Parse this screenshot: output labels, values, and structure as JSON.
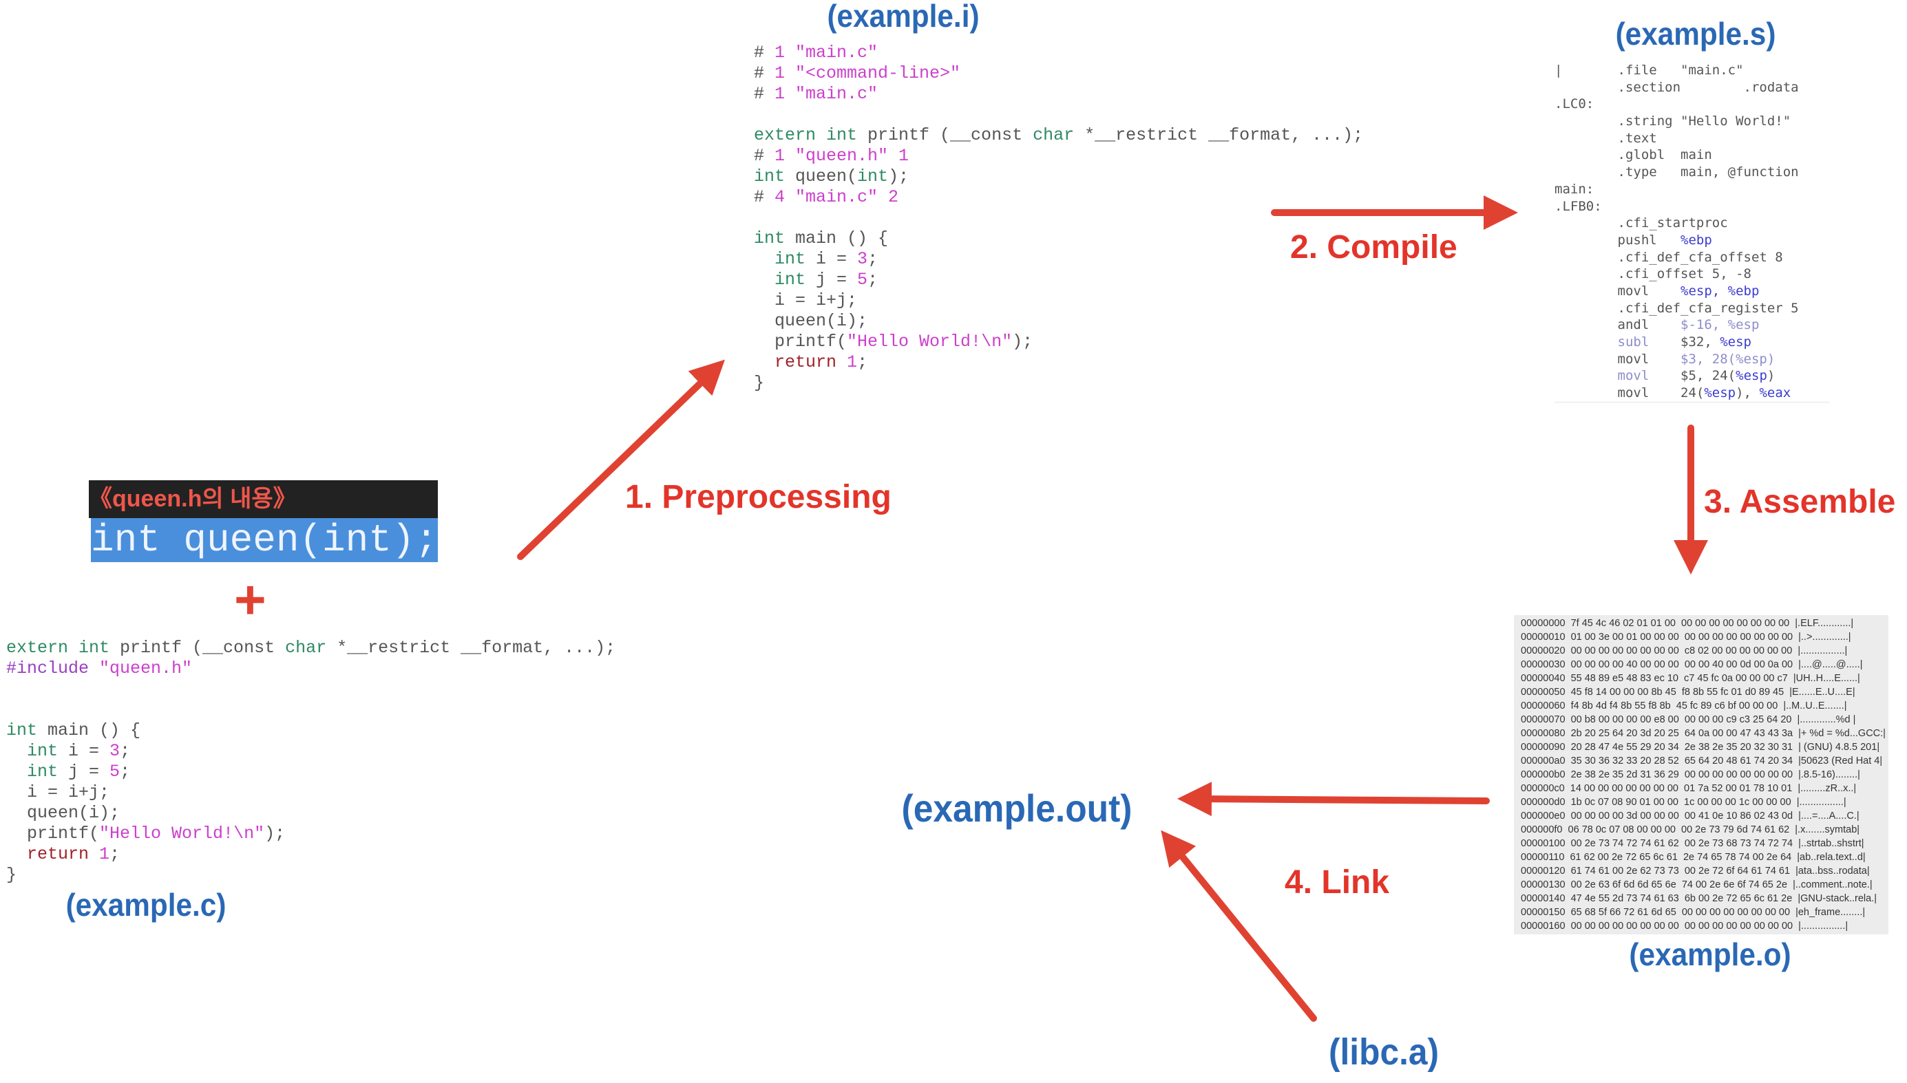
{
  "colors": {
    "kw": "#2f8a63",
    "str": "#cc3fcc",
    "num": "#cc3fcc",
    "ret": "#a0222a",
    "txt": "#555555",
    "pre": "#9b3fc0",
    "reg": "#3b3bd0",
    "faint": "#8d8dcc",
    "arrow": "#e04232",
    "step": "#e3342a",
    "title": "#2a68b5"
  },
  "titles": {
    "example_i": "(example.i)",
    "example_s": "(example.s)",
    "example_o": "(example.o)",
    "example_c": "(example.c)",
    "example_out": "(example.out)",
    "libc": "(libc.a)"
  },
  "steps": {
    "preprocessing": "1.  Preprocessing",
    "compile": "2.  Compile",
    "assemble": "3.  Assemble",
    "link": "4.  Link"
  },
  "queen_header": {
    "title": "《queen.h의 내용》",
    "content": "int queen(int);"
  },
  "plus": "+",
  "example_i_code": [
    [
      [
        "# ",
        "txt"
      ],
      [
        "1 \"main.c\"",
        "str"
      ]
    ],
    [
      [
        "# ",
        "txt"
      ],
      [
        "1 \"<command-line>\"",
        "str"
      ]
    ],
    [
      [
        "# ",
        "txt"
      ],
      [
        "1 \"main.c\"",
        "str"
      ]
    ],
    [],
    [
      [
        "extern int",
        "kw"
      ],
      [
        " printf (__const ",
        "txt"
      ],
      [
        "char",
        "kw"
      ],
      [
        " *__restrict __format, ...);",
        "txt"
      ]
    ],
    [
      [
        "# ",
        "txt"
      ],
      [
        "1 \"queen.h\" 1",
        "str"
      ]
    ],
    [
      [
        "int",
        "kw"
      ],
      [
        " queen(",
        "txt"
      ],
      [
        "int",
        "kw"
      ],
      [
        ");",
        "txt"
      ]
    ],
    [
      [
        "# ",
        "txt"
      ],
      [
        "4 \"main.c\" 2",
        "str"
      ]
    ],
    [],
    [
      [
        "int",
        "kw"
      ],
      [
        " main () {",
        "txt"
      ]
    ],
    [
      [
        "  ",
        "txt"
      ],
      [
        "int",
        "kw"
      ],
      [
        " i = ",
        "txt"
      ],
      [
        "3",
        "num"
      ],
      [
        ";",
        "txt"
      ]
    ],
    [
      [
        "  ",
        "txt"
      ],
      [
        "int",
        "kw"
      ],
      [
        " j = ",
        "txt"
      ],
      [
        "5",
        "num"
      ],
      [
        ";",
        "txt"
      ]
    ],
    [
      [
        "  i = i+j;",
        "txt"
      ]
    ],
    [
      [
        "  queen(i);",
        "txt"
      ]
    ],
    [
      [
        "  printf(",
        "txt"
      ],
      [
        "\"Hello World!\\n\"",
        "str"
      ],
      [
        ");",
        "txt"
      ]
    ],
    [
      [
        "  ",
        "txt"
      ],
      [
        "return",
        "ret"
      ],
      [
        " ",
        "txt"
      ],
      [
        "1",
        "num"
      ],
      [
        ";",
        "txt"
      ]
    ],
    [
      [
        "}",
        "txt"
      ]
    ]
  ],
  "example_c_code": [
    [
      [
        "extern int",
        "kw"
      ],
      [
        " printf (__const ",
        "txt"
      ],
      [
        "char",
        "kw"
      ],
      [
        " *__restrict __format, ...);",
        "txt"
      ]
    ],
    [
      [
        "#include ",
        "pre"
      ],
      [
        "\"queen.h\"",
        "str"
      ]
    ],
    [],
    [],
    [
      [
        "int",
        "kw"
      ],
      [
        " main () {",
        "txt"
      ]
    ],
    [
      [
        "  ",
        "txt"
      ],
      [
        "int",
        "kw"
      ],
      [
        " i = ",
        "txt"
      ],
      [
        "3",
        "num"
      ],
      [
        ";",
        "txt"
      ]
    ],
    [
      [
        "  ",
        "txt"
      ],
      [
        "int",
        "kw"
      ],
      [
        " j = ",
        "txt"
      ],
      [
        "5",
        "num"
      ],
      [
        ";",
        "txt"
      ]
    ],
    [
      [
        "  i = i+j;",
        "txt"
      ]
    ],
    [
      [
        "  queen(i);",
        "txt"
      ]
    ],
    [
      [
        "  printf(",
        "txt"
      ],
      [
        "\"Hello World!\\n\"",
        "str"
      ],
      [
        ");",
        "txt"
      ]
    ],
    [
      [
        "  ",
        "txt"
      ],
      [
        "return",
        "ret"
      ],
      [
        " ",
        "txt"
      ],
      [
        "1",
        "num"
      ],
      [
        ";",
        "txt"
      ]
    ],
    [
      [
        "}",
        "txt"
      ]
    ]
  ],
  "example_s_code": [
    [
      [
        "|       .file   \"main.c\"",
        "txt"
      ]
    ],
    [
      [
        "        .section        .rodata",
        "txt"
      ]
    ],
    [
      [
        ".LC0:",
        "txt"
      ]
    ],
    [
      [
        "        .string \"Hello World!\"",
        "txt"
      ]
    ],
    [
      [
        "        .text",
        "txt"
      ]
    ],
    [
      [
        "        .globl  main",
        "txt"
      ]
    ],
    [
      [
        "        .type   main, @function",
        "txt"
      ]
    ],
    [
      [
        "main:",
        "txt"
      ]
    ],
    [
      [
        ".LFB0:",
        "txt"
      ]
    ],
    [
      [
        "        .cfi_startproc",
        "txt"
      ]
    ],
    [
      [
        "        pushl   ",
        "txt"
      ],
      [
        "%ebp",
        "reg"
      ]
    ],
    [
      [
        "        .cfi_def_cfa_offset 8",
        "txt"
      ]
    ],
    [
      [
        "        .cfi_offset 5, -8",
        "txt"
      ]
    ],
    [
      [
        "        movl    ",
        "txt"
      ],
      [
        "%esp, %ebp",
        "reg"
      ]
    ],
    [
      [
        "        .cfi_def_cfa_register 5",
        "txt"
      ]
    ],
    [
      [
        "        andl    ",
        "txt"
      ],
      [
        "$-16, %esp",
        "faint"
      ]
    ],
    [
      [
        "        ",
        "txt"
      ],
      [
        "subl",
        "faint"
      ],
      [
        "    $32, ",
        "txt"
      ],
      [
        "%esp",
        "reg"
      ]
    ],
    [
      [
        "        movl    ",
        "txt"
      ],
      [
        "$3, 28(%esp)",
        "faint"
      ]
    ],
    [
      [
        "        ",
        "txt"
      ],
      [
        "movl",
        "faint"
      ],
      [
        "    $5, 24(",
        "txt"
      ],
      [
        "%esp",
        "reg"
      ],
      [
        ")",
        "txt"
      ]
    ],
    [
      [
        "        movl    24(",
        "txt"
      ],
      [
        "%esp",
        "reg"
      ],
      [
        "), ",
        "txt"
      ],
      [
        "%eax",
        "reg"
      ]
    ]
  ],
  "example_o_hex": [
    "00000000  7f 45 4c 46 02 01 01 00  00 00 00 00 00 00 00 00  |.ELF............|",
    "00000010  01 00 3e 00 01 00 00 00  00 00 00 00 00 00 00 00  |..>.............|",
    "00000020  00 00 00 00 00 00 00 00  c8 02 00 00 00 00 00 00  |................|",
    "00000030  00 00 00 00 40 00 00 00  00 00 40 00 0d 00 0a 00  |....@.....@.....|",
    "00000040  55 48 89 e5 48 83 ec 10  c7 45 fc 0a 00 00 00 c7  |UH..H....E......|",
    "00000050  45 f8 14 00 00 00 8b 45  f8 8b 55 fc 01 d0 89 45  |E......E..U....E|",
    "00000060  f4 8b 4d f4 8b 55 f8 8b  45 fc 89 c6 bf 00 00 00  |..M..U..E.......|",
    "00000070  00 b8 00 00 00 00 e8 00  00 00 00 c9 c3 25 64 20  |.............%d |",
    "00000080  2b 20 25 64 20 3d 20 25  64 0a 00 00 47 43 43 3a  |+ %d = %d...GCC:|",
    "00000090  20 28 47 4e 55 29 20 34  2e 38 2e 35 20 32 30 31  | (GNU) 4.8.5 201|",
    "000000a0  35 30 36 32 33 20 28 52  65 64 20 48 61 74 20 34  |50623 (Red Hat 4|",
    "000000b0  2e 38 2e 35 2d 31 36 29  00 00 00 00 00 00 00 00  |.8.5-16)........|",
    "000000c0  14 00 00 00 00 00 00 00  01 7a 52 00 01 78 10 01  |.........zR..x..|",
    "000000d0  1b 0c 07 08 90 01 00 00  1c 00 00 00 1c 00 00 00  |................|",
    "000000e0  00 00 00 00 3d 00 00 00  00 41 0e 10 86 02 43 0d  |....=....A....C.|",
    "000000f0  06 78 0c 07 08 00 00 00  00 2e 73 79 6d 74 61 62  |.x.......symtab|",
    "00000100  00 2e 73 74 72 74 61 62  00 2e 73 68 73 74 72 74  |..strtab..shstrt|",
    "00000110  61 62 00 2e 72 65 6c 61  2e 74 65 78 74 00 2e 64  |ab..rela.text..d|",
    "00000120  61 74 61 00 2e 62 73 73  00 2e 72 6f 64 61 74 61  |ata..bss..rodata|",
    "00000130  00 2e 63 6f 6d 6d 65 6e  74 00 2e 6e 6f 74 65 2e  |..comment..note.|",
    "00000140  47 4e 55 2d 73 74 61 63  6b 00 2e 72 65 6c 61 2e  |GNU-stack..rela.|",
    "00000150  65 68 5f 66 72 61 6d 65  00 00 00 00 00 00 00 00  |eh_frame........|",
    "00000160  00 00 00 00 00 00 00 00  00 00 00 00 00 00 00 00  |................|"
  ]
}
